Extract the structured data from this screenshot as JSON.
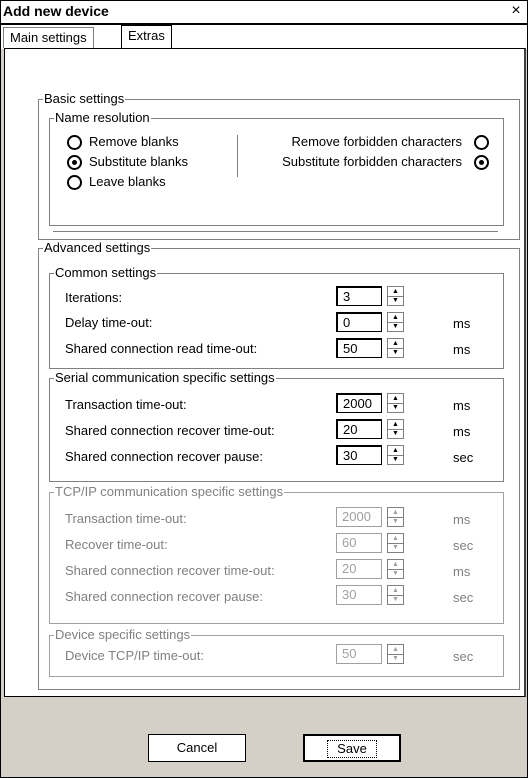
{
  "window": {
    "title": "Add new device",
    "close_glyph": "×"
  },
  "tabs": [
    {
      "label": "Main settings",
      "active": false
    },
    {
      "label": "Extras",
      "active": true
    }
  ],
  "basic": {
    "legend": "Basic settings",
    "name_resolution": {
      "legend": "Name resolution",
      "left_options": [
        {
          "label": "Remove blanks",
          "selected": false
        },
        {
          "label": "Substitute blanks",
          "selected": true
        },
        {
          "label": "Leave blanks",
          "selected": false
        }
      ],
      "right_options": [
        {
          "label": "Remove forbidden characters",
          "selected": false
        },
        {
          "label": "Substitute forbidden characters",
          "selected": true
        }
      ]
    }
  },
  "advanced": {
    "legend": "Advanced settings",
    "common": {
      "legend": "Common settings",
      "rows": [
        {
          "label": "Iterations:",
          "value": "3",
          "unit": ""
        },
        {
          "label": "Delay time-out:",
          "value": "0",
          "unit": "ms"
        },
        {
          "label": "Shared connection read time-out:",
          "value": "50",
          "unit": "ms"
        }
      ]
    },
    "serial": {
      "legend": "Serial communication specific settings",
      "rows": [
        {
          "label": "Transaction time-out:",
          "value": "2000",
          "unit": "ms"
        },
        {
          "label": "Shared connection recover time-out:",
          "value": "20",
          "unit": "ms"
        },
        {
          "label": "Shared connection recover pause:",
          "value": "30",
          "unit": "sec"
        }
      ]
    },
    "tcpip": {
      "legend": "TCP/IP communication specific settings",
      "disabled": true,
      "rows": [
        {
          "label": "Transaction time-out:",
          "value": "2000",
          "unit": "ms"
        },
        {
          "label": "Recover time-out:",
          "value": "60",
          "unit": "sec"
        },
        {
          "label": "Shared connection recover time-out:",
          "value": "20",
          "unit": "ms"
        },
        {
          "label": "Shared connection recover pause:",
          "value": "30",
          "unit": "sec"
        }
      ]
    },
    "device": {
      "legend": "Device specific settings",
      "disabled": true,
      "rows": [
        {
          "label": "Device TCP/IP time-out:",
          "value": "50",
          "unit": "sec"
        }
      ]
    }
  },
  "buttons": {
    "cancel": "Cancel",
    "save": "Save"
  }
}
